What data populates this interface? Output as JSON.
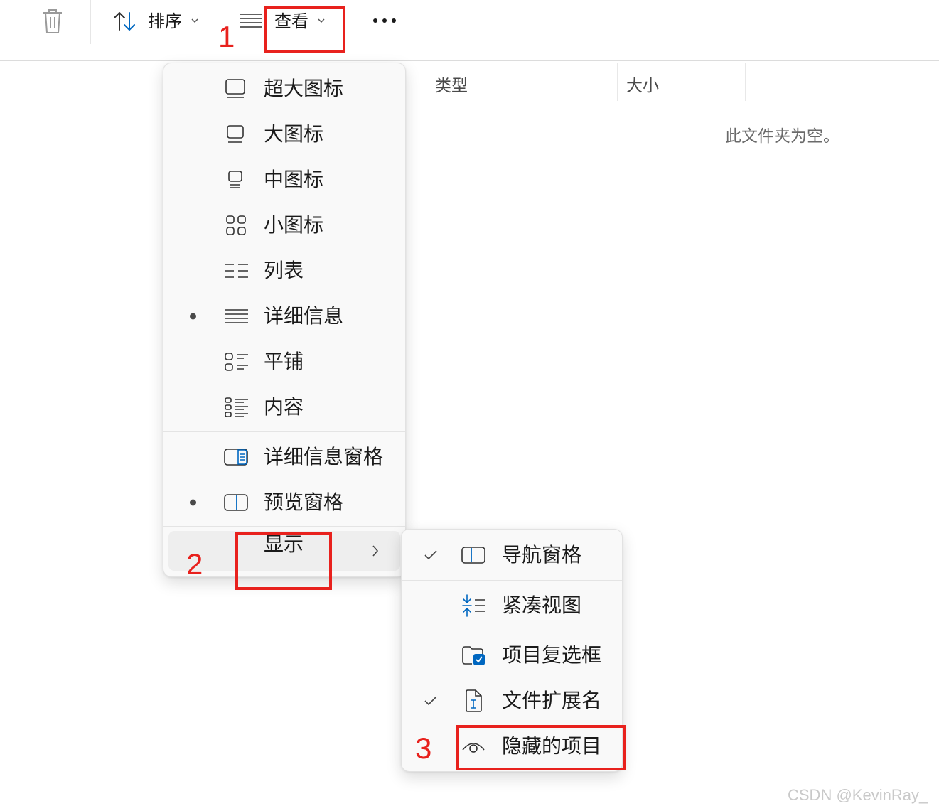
{
  "toolbar": {
    "sort_label": "排序",
    "view_label": "查看",
    "more_label": "•••"
  },
  "columns": {
    "type_label": "类型",
    "size_label": "大小"
  },
  "empty_message": "此文件夹为空。",
  "view_menu": {
    "items": [
      {
        "label": "超大图标"
      },
      {
        "label": "大图标"
      },
      {
        "label": "中图标"
      },
      {
        "label": "小图标"
      },
      {
        "label": "列表"
      },
      {
        "label": "详细信息",
        "selected": true
      },
      {
        "label": "平铺"
      },
      {
        "label": "内容"
      },
      {
        "label": "详细信息窗格"
      },
      {
        "label": "预览窗格",
        "selected": true
      },
      {
        "label": "显示"
      }
    ]
  },
  "show_menu": {
    "items": [
      {
        "label": "导航窗格",
        "checked": true
      },
      {
        "label": "紧凑视图"
      },
      {
        "label": "项目复选框"
      },
      {
        "label": "文件扩展名",
        "checked": true
      },
      {
        "label": "隐藏的项目"
      }
    ]
  },
  "annotations": [
    "1",
    "2",
    "3"
  ],
  "watermark": "CSDN @KevinRay_",
  "colors": {
    "accent": "#0067c0",
    "annotation": "#e8211d"
  }
}
